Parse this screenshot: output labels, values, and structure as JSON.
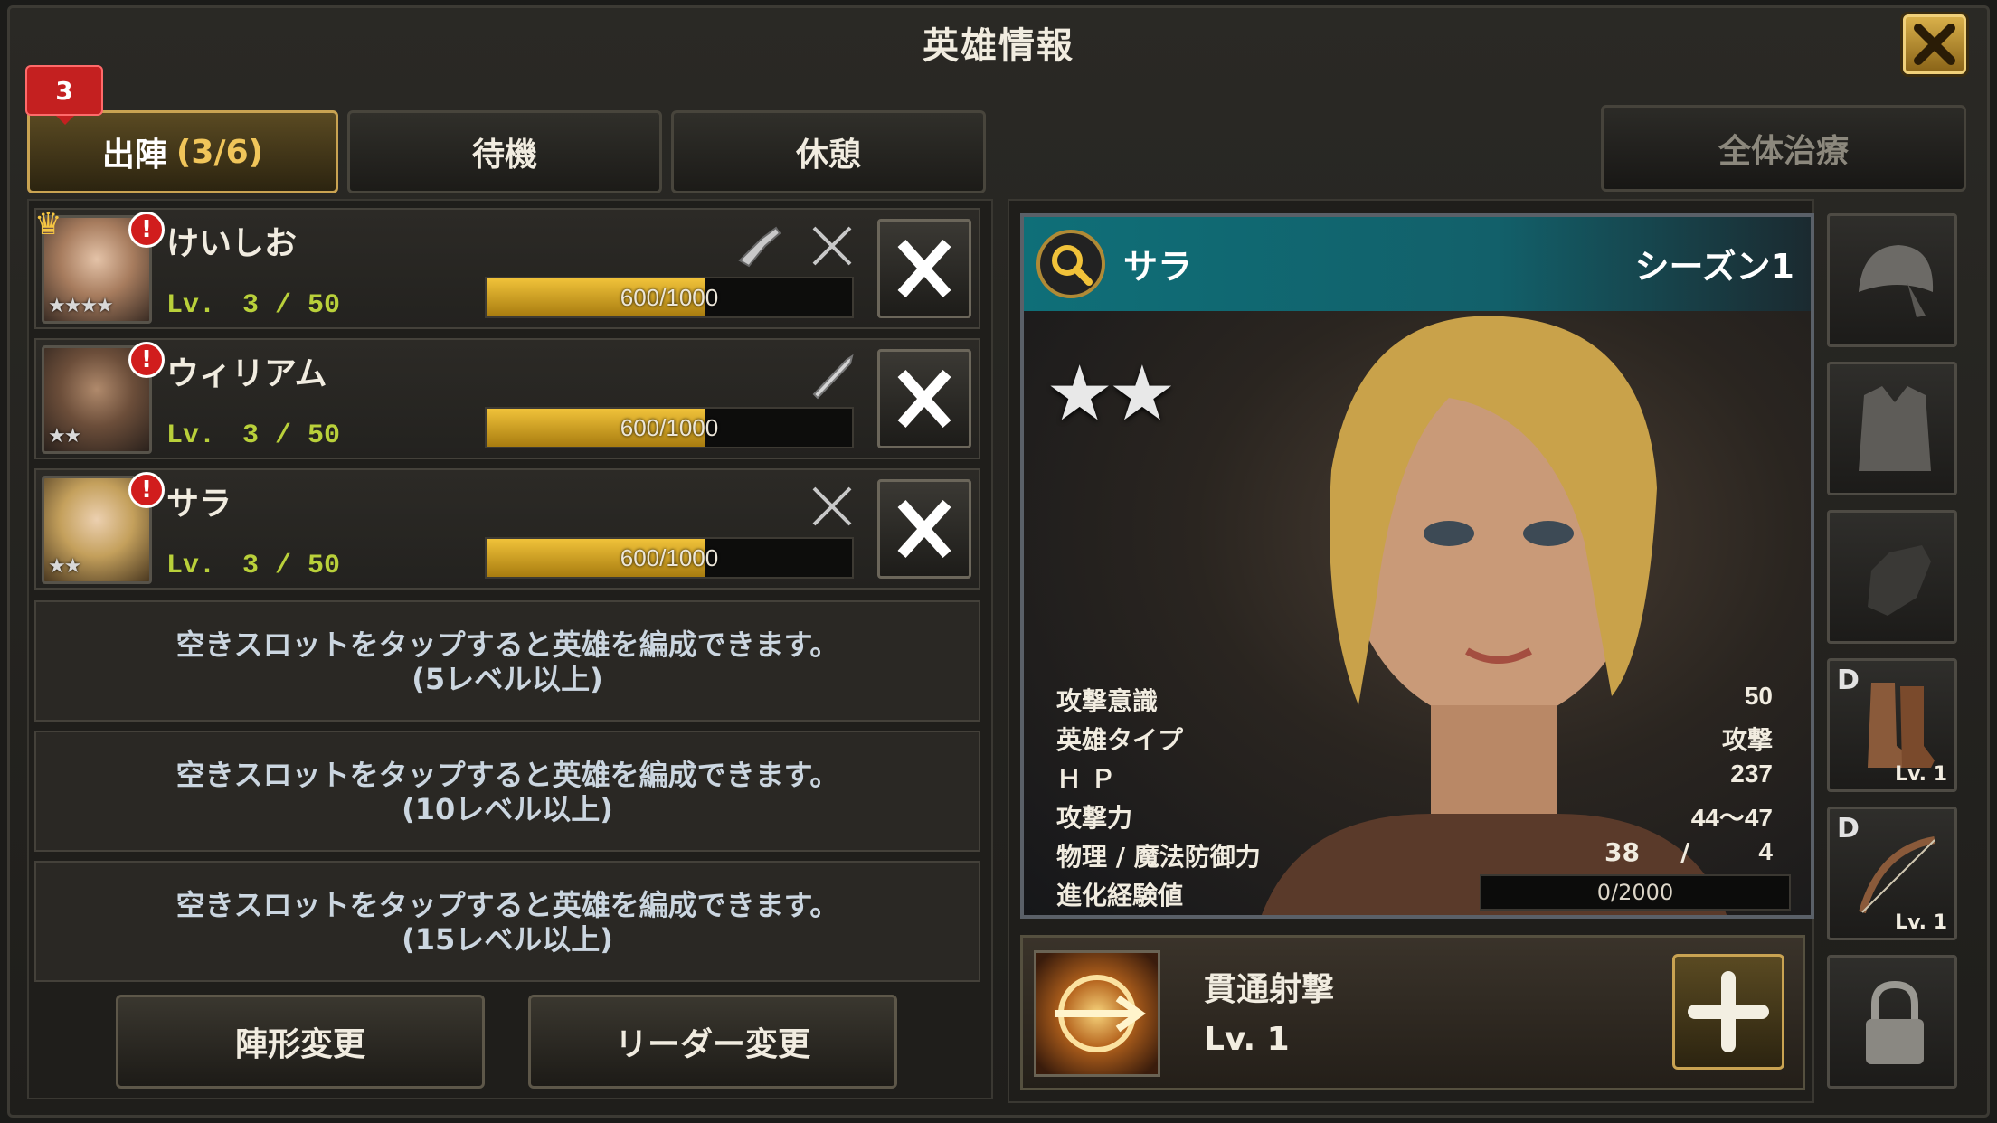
{
  "title": "英雄情報",
  "tabs": [
    {
      "label": "出陣",
      "count": "(3/6)",
      "badge": "3"
    },
    {
      "label": "待機"
    },
    {
      "label": "休憩"
    }
  ],
  "heal_all_label": "全体治療",
  "heroes": [
    {
      "name": "けいしお",
      "lv": "Lv.　3 / 50",
      "xp": "600/1000",
      "xp_fraction": 0.6,
      "stars": "★★★★",
      "leader": true
    },
    {
      "name": "ウィリアム",
      "lv": "Lv.　3 / 50",
      "xp": "600/1000",
      "xp_fraction": 0.6,
      "stars": "★★",
      "leader": false
    },
    {
      "name": "サラ",
      "lv": "Lv.　3 / 50",
      "xp": "600/1000",
      "xp_fraction": 0.6,
      "stars": "★★",
      "leader": false
    }
  ],
  "empty_slots": [
    {
      "line1": "空きスロットをタップすると英雄を編成できます。",
      "line2": "(5レベル以上)"
    },
    {
      "line1": "空きスロットをタップすると英雄を編成できます。",
      "line2": "(10レベル以上)"
    },
    {
      "line1": "空きスロットをタップすると英雄を編成できます。",
      "line2": "(15レベル以上)"
    }
  ],
  "buttons": {
    "formation": "陣形変更",
    "leader": "リーダー変更"
  },
  "card": {
    "name": "サラ",
    "season": "シーズン1",
    "stars": "★★",
    "stats": [
      {
        "label": "攻撃意識",
        "value": "50"
      },
      {
        "label": "英雄タイプ",
        "value": "攻撃"
      },
      {
        "label": "Ｈ Ｐ",
        "value": "237"
      },
      {
        "label": "攻撃力",
        "value": "44～47"
      }
    ],
    "defense": {
      "label": "物理 / 魔法防御力",
      "physical": "38",
      "sep": "/",
      "magic": "4"
    },
    "evolution": {
      "label": "進化経験値",
      "value": "0/2000"
    }
  },
  "skill": {
    "name": "貫通射撃",
    "lv": "Lv. 1"
  },
  "equipment": [
    {
      "name": "headband-icon"
    },
    {
      "name": "vest-icon"
    },
    {
      "name": "glove-icon"
    },
    {
      "name": "boots-icon",
      "grade": "D",
      "lv": "Lv. 1"
    },
    {
      "name": "bow-icon",
      "grade": "D",
      "lv": "Lv. 1"
    },
    {
      "name": "lock-icon"
    }
  ],
  "colors": {
    "accent_gold": "#c9a352",
    "level_green": "#b9d03a",
    "header_teal": "#0f6f78",
    "alert_red": "#d11d1d"
  }
}
